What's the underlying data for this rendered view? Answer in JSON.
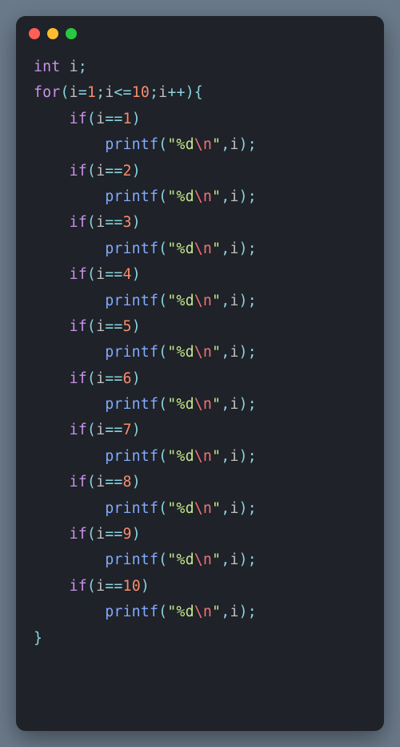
{
  "window": {
    "traffic_lights": [
      "close",
      "minimize",
      "zoom"
    ]
  },
  "syntax": {
    "kw_int": "int",
    "kw_for": "for",
    "kw_if": "if",
    "ident_i": "i",
    "func_printf": "printf",
    "str_open": "\"%d",
    "esc_n": "\\n",
    "str_close": "\"",
    "semi": ";",
    "lparen": "(",
    "rparen": ")",
    "lbrace": "{",
    "rbrace": "}",
    "comma": ",",
    "eq": "=",
    "deq": "==",
    "lte": "<=",
    "inc": "++",
    "sp": " "
  },
  "loop": {
    "start": "1",
    "end": "10",
    "items": [
      "1",
      "2",
      "3",
      "4",
      "5",
      "6",
      "7",
      "8",
      "9",
      "10"
    ]
  }
}
